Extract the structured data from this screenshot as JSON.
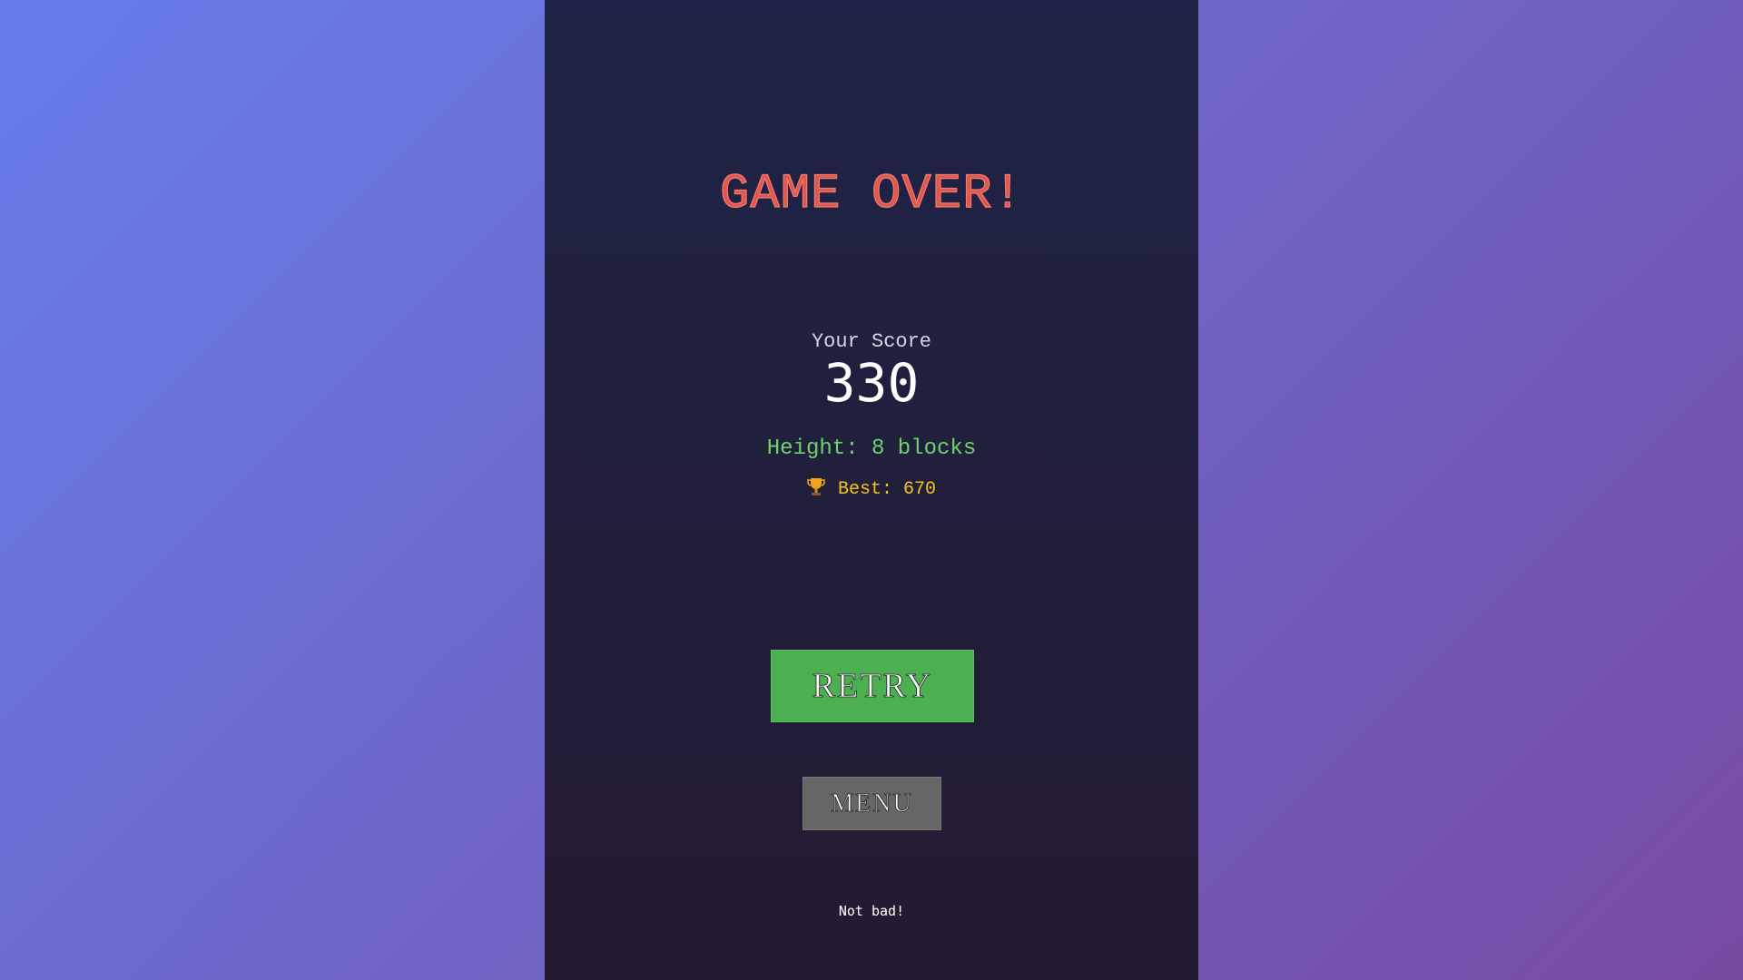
{
  "game": {
    "title": "GAME OVER!",
    "score_label": "Your Score",
    "score_value": "330",
    "height_text": "Height: 8 blocks",
    "best_text": "Best: 670",
    "best_icon": "trophy-icon",
    "retry_label": "RETRY",
    "menu_label": "MENU",
    "footer_message": "Not bad!"
  },
  "colors": {
    "background_start": "#667eea",
    "background_end": "#764ba2",
    "panel": "#1e2447",
    "title": "#e0574d",
    "height_text": "#6fd36a",
    "best_text": "#f5c518",
    "retry_button": "#4caf50",
    "menu_button": "#666666"
  }
}
